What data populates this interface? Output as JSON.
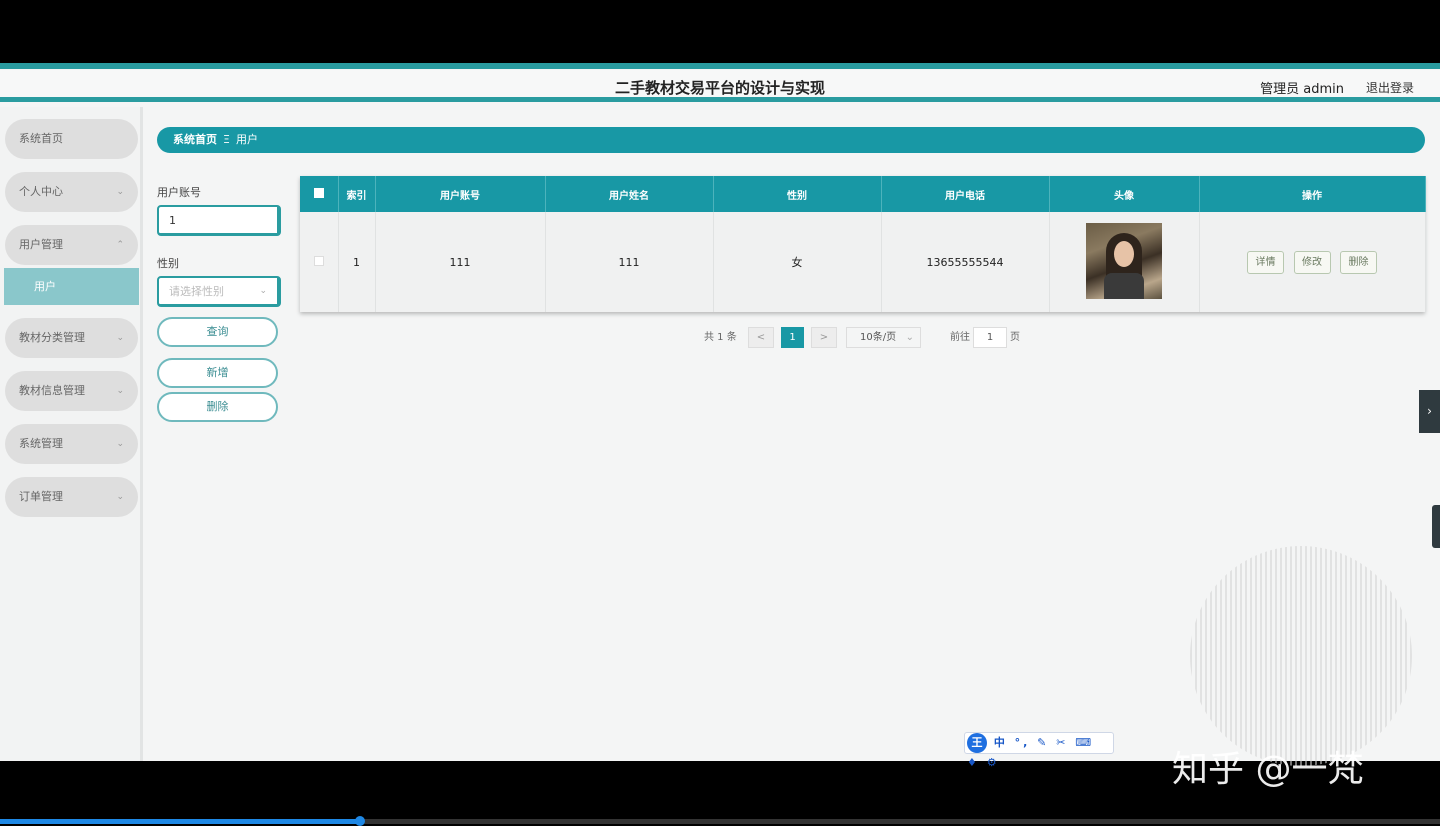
{
  "header": {
    "title": "二手教材交易平台的设计与实现",
    "user": "管理员 admin",
    "logout": "退出登录"
  },
  "sidebar": {
    "items": [
      {
        "label": "系统首页",
        "has_chevron": false
      },
      {
        "label": "个人中心",
        "has_chevron": true,
        "chevron": "⌄"
      },
      {
        "label": "用户管理",
        "has_chevron": true,
        "chevron": "⌃"
      },
      {
        "label": "教材分类管理",
        "has_chevron": true,
        "chevron": "⌄"
      },
      {
        "label": "教材信息管理",
        "has_chevron": true,
        "chevron": "⌄"
      },
      {
        "label": "系统管理",
        "has_chevron": true,
        "chevron": "⌄"
      },
      {
        "label": "订单管理",
        "has_chevron": true,
        "chevron": "⌄"
      }
    ],
    "sub_active": "用户"
  },
  "breadcrumb": {
    "home": "系统首页",
    "separator": "Ξ",
    "current": "用户"
  },
  "search": {
    "account_label": "用户账号",
    "account_value": "1",
    "gender_label": "性别",
    "gender_placeholder": "请选择性别",
    "query_button": "查询",
    "add_button": "新增",
    "delete_button": "删除"
  },
  "table": {
    "columns": [
      "索引",
      "用户账号",
      "用户姓名",
      "性别",
      "用户电话",
      "头像",
      "操作"
    ],
    "rows": [
      {
        "index": "1",
        "account": "111",
        "name": "111",
        "gender": "女",
        "phone": "13655555544"
      }
    ],
    "actions": {
      "detail": "详情",
      "edit": "修改",
      "delete": "删除"
    }
  },
  "pagination": {
    "total": "共 1 条",
    "prev": "<",
    "page": "1",
    "next": ">",
    "page_size": "10条/页",
    "goto_label": "前往",
    "goto_value": "1",
    "page_suffix": "页"
  },
  "ime_toolbar": {
    "logo": "王",
    "items": "中 °, ✎ ✂ ⌨ ♦ ⚙"
  },
  "watermark": "知乎 @一梵",
  "colors": {
    "accent": "#1898a5",
    "header_line": "#2a9ca0",
    "active_sub": "#8ac7cb"
  },
  "video_progress": 0.25
}
